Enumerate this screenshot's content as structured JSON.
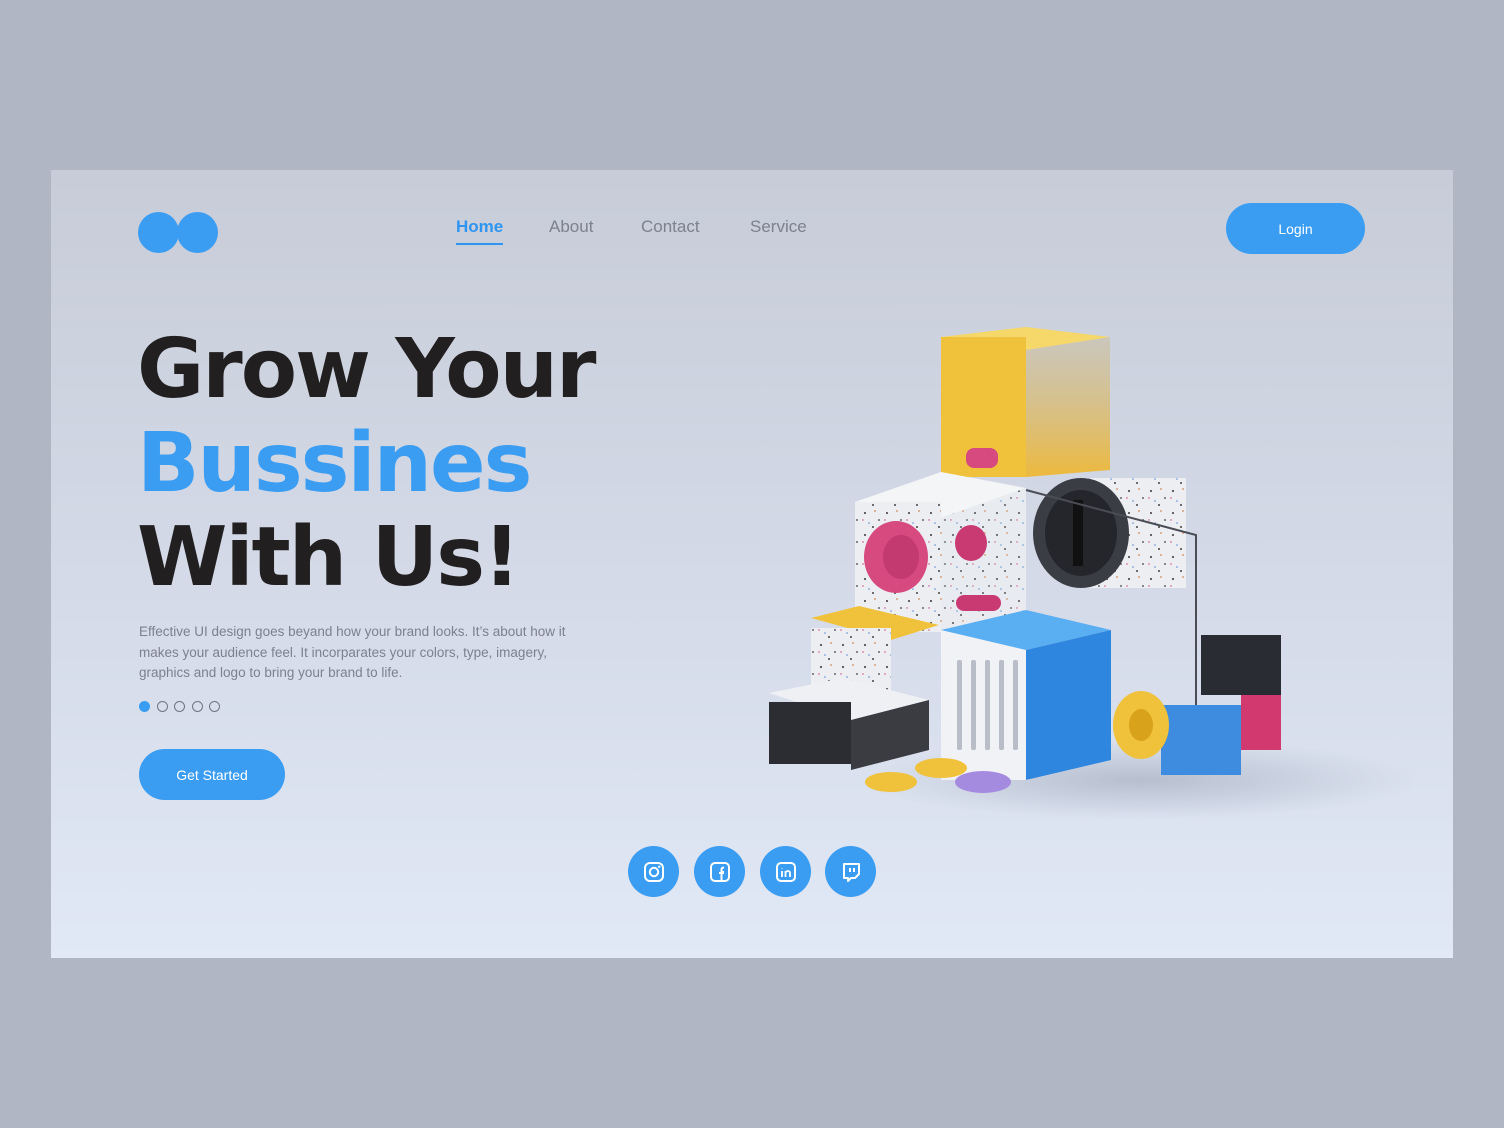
{
  "nav": {
    "items": [
      {
        "label": "Home",
        "active": true
      },
      {
        "label": "About",
        "active": false
      },
      {
        "label": "Contact",
        "active": false
      },
      {
        "label": "Service",
        "active": false
      }
    ],
    "login_label": "Login"
  },
  "hero": {
    "line1": "Grow Your",
    "line2": "Bussines",
    "line3": "With Us!",
    "description": "Effective UI design goes beyand how your brand looks. It’s about how it makes your audience feel. It incorparates your colors, type, imagery, graphics and logo to bring your brand to life.",
    "cta_label": "Get Started",
    "carousel": {
      "total": 5,
      "active": 1
    }
  },
  "social": [
    {
      "icon": "instagram-icon"
    },
    {
      "icon": "facebook-icon"
    },
    {
      "icon": "linkedin-icon"
    },
    {
      "icon": "twitch-icon"
    }
  ],
  "colors": {
    "accent": "#3a9df2",
    "text_dark": "#221f20",
    "text_muted": "#7c818d",
    "outer_bg": "#b0b6c4"
  }
}
